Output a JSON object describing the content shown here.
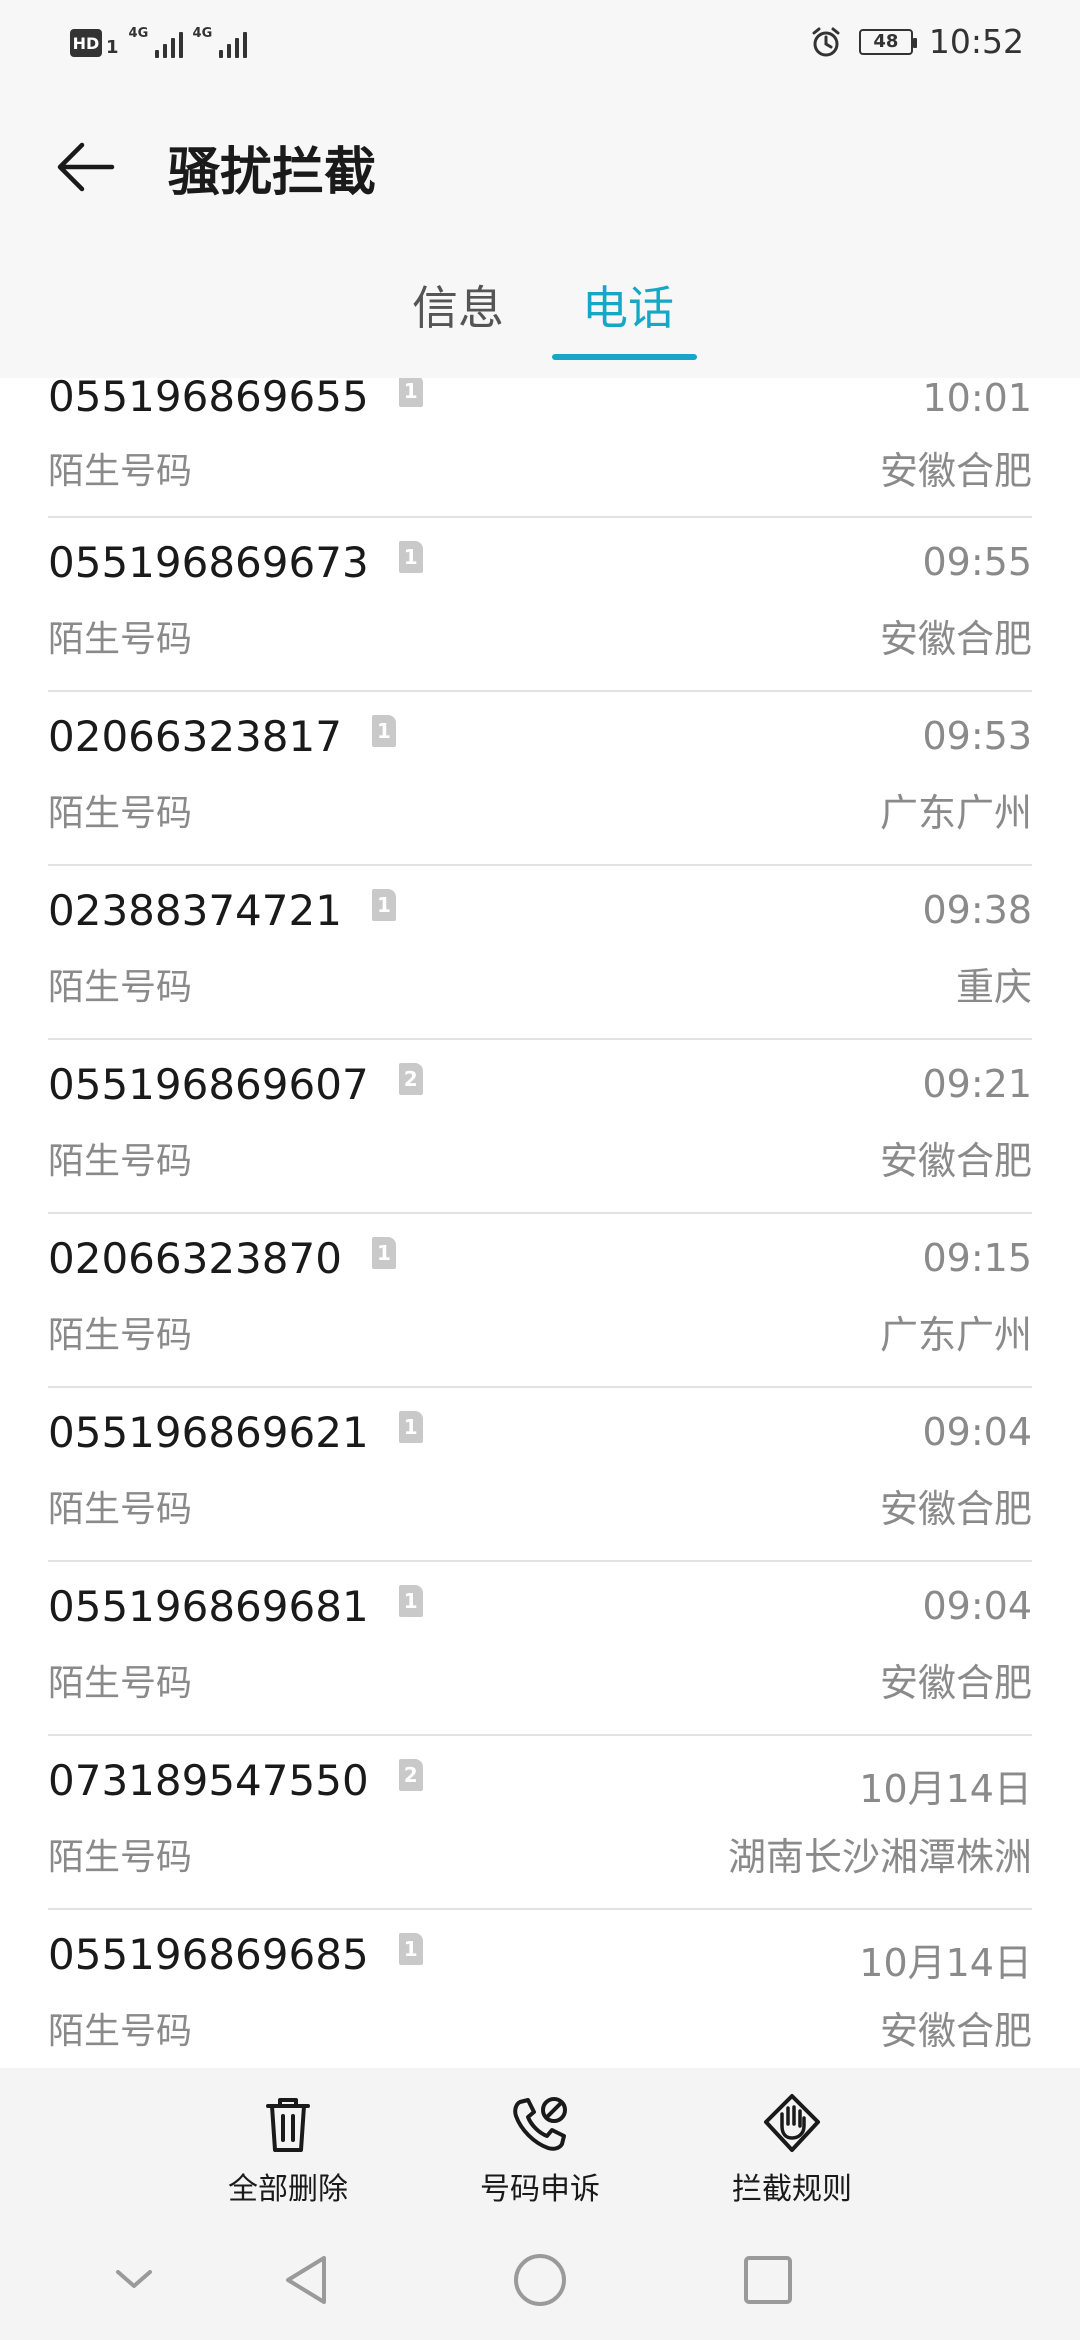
{
  "status_bar": {
    "hd_label": "HD",
    "sim_sub": "1",
    "net1": "4G",
    "net2": "4G",
    "battery": "48",
    "time": "10:52"
  },
  "header": {
    "title": "骚扰拦截",
    "tabs": [
      {
        "label": "信息",
        "active": false
      },
      {
        "label": "电话",
        "active": true
      }
    ],
    "accent_color": "#16a7c6"
  },
  "calls": [
    {
      "number": "055196869655",
      "sim": "1",
      "label": "陌生号码",
      "time": "10:01",
      "location": "安徽合肥"
    },
    {
      "number": "055196869673",
      "sim": "1",
      "label": "陌生号码",
      "time": "09:55",
      "location": "安徽合肥"
    },
    {
      "number": "02066323817",
      "sim": "1",
      "label": "陌生号码",
      "time": "09:53",
      "location": "广东广州"
    },
    {
      "number": "02388374721",
      "sim": "1",
      "label": "陌生号码",
      "time": "09:38",
      "location": "重庆"
    },
    {
      "number": "055196869607",
      "sim": "2",
      "label": "陌生号码",
      "time": "09:21",
      "location": "安徽合肥"
    },
    {
      "number": "02066323870",
      "sim": "1",
      "label": "陌生号码",
      "time": "09:15",
      "location": "广东广州"
    },
    {
      "number": "055196869621",
      "sim": "1",
      "label": "陌生号码",
      "time": "09:04",
      "location": "安徽合肥"
    },
    {
      "number": "055196869681",
      "sim": "1",
      "label": "陌生号码",
      "time": "09:04",
      "location": "安徽合肥"
    },
    {
      "number": "073189547550",
      "sim": "2",
      "label": "陌生号码",
      "time": "10月14日",
      "location": "湖南长沙湘潭株洲"
    },
    {
      "number": "055196869685",
      "sim": "1",
      "label": "陌生号码",
      "time": "10月14日",
      "location": "安徽合肥"
    }
  ],
  "bottom_actions": [
    {
      "label": "全部删除",
      "icon": "trash-icon"
    },
    {
      "label": "号码申诉",
      "icon": "phone-blocked-icon"
    },
    {
      "label": "拦截规则",
      "icon": "hand-block-icon"
    }
  ],
  "nav": [
    "chevron-down-icon",
    "back-triangle-icon",
    "home-circle-icon",
    "recents-square-icon"
  ]
}
